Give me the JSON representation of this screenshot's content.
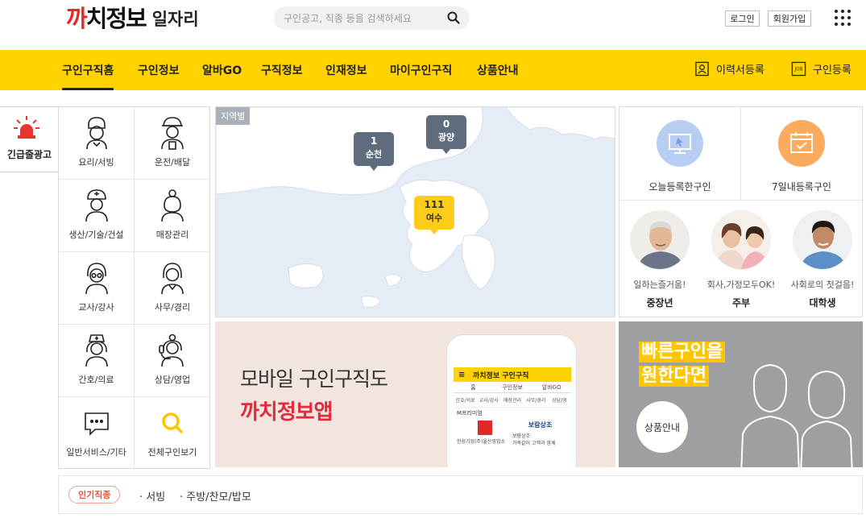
{
  "header": {
    "logo_main": "까치정보",
    "logo_sub": "일자리",
    "search_placeholder": "구인공고, 직종 등을 검색하세요",
    "login_label": "로그인",
    "join_label": "회원가입"
  },
  "nav": {
    "items": [
      "구인구직홈",
      "구인정보",
      "알바GO",
      "구직정보",
      "인재정보",
      "마이구인구직",
      "상품안내"
    ],
    "active_index": 0,
    "resume_label": "이력서등록",
    "job_post_label": "구인등록",
    "job_icon_text": "JOB"
  },
  "emergency": {
    "label": "긴급줄광고"
  },
  "categories": [
    {
      "label": "요리/서빙",
      "icon": "chef-icon"
    },
    {
      "label": "운전/배달",
      "icon": "driver-icon"
    },
    {
      "label": "생산/기술/건설",
      "icon": "worker-icon"
    },
    {
      "label": "매장관리",
      "icon": "store-clerk-icon"
    },
    {
      "label": "교사/강사",
      "icon": "teacher-icon"
    },
    {
      "label": "사무/경리",
      "icon": "office-icon"
    },
    {
      "label": "간호/의료",
      "icon": "nurse-icon"
    },
    {
      "label": "상담/영업",
      "icon": "consult-icon"
    },
    {
      "label": "일반서비스/기타",
      "icon": "chat-icon"
    },
    {
      "label": "전체구인보기",
      "icon": "search-icon"
    }
  ],
  "map": {
    "tag": "지역별",
    "markers": [
      {
        "count": "1",
        "city": "순천"
      },
      {
        "count": "0",
        "city": "광양"
      },
      {
        "count": "111",
        "city": "여수"
      }
    ]
  },
  "recent": {
    "today_label": "오늘등록한구인",
    "week_label": "7일내등록구인"
  },
  "personas": [
    {
      "tagline": "일하는즐거움!",
      "name": "중장년"
    },
    {
      "tagline": "회사,가정모두OK!",
      "name": "주부"
    },
    {
      "tagline": "사회로의 첫걸음!",
      "name": "대학생"
    }
  ],
  "app_banner": {
    "line1": "모바일 구인구직도",
    "line2": "까치정보앱",
    "phone_title": "까치정보 구인구직",
    "phone_tabs": [
      "홈",
      "구인정보",
      "알바GO"
    ],
    "phone_icons": [
      "간호/의료",
      "교사/강사",
      "매장관리",
      "사무/경리",
      "상담/영"
    ],
    "phone_premium": "M프리미엄",
    "phone_ad1": "한성기업(주)울산영업소",
    "phone_ad2": "보람상조",
    "phone_ad2_sub": "보람상조",
    "phone_ad2_detail": "가족같이 고객과 함께"
  },
  "product_banner": {
    "line1": "빠른구인을",
    "line2": "원한다면",
    "button": "상품안내"
  },
  "popular": {
    "badge": "인기직종",
    "keywords": [
      "서빙",
      "주방/찬모/밥모"
    ]
  },
  "colors": {
    "nav_bg": "#ffd200",
    "logo_red": "#e32a2a",
    "marker_gray": "#5f6c7d",
    "marker_yellow": "#ffcc1a",
    "app_red": "#e5283c"
  }
}
